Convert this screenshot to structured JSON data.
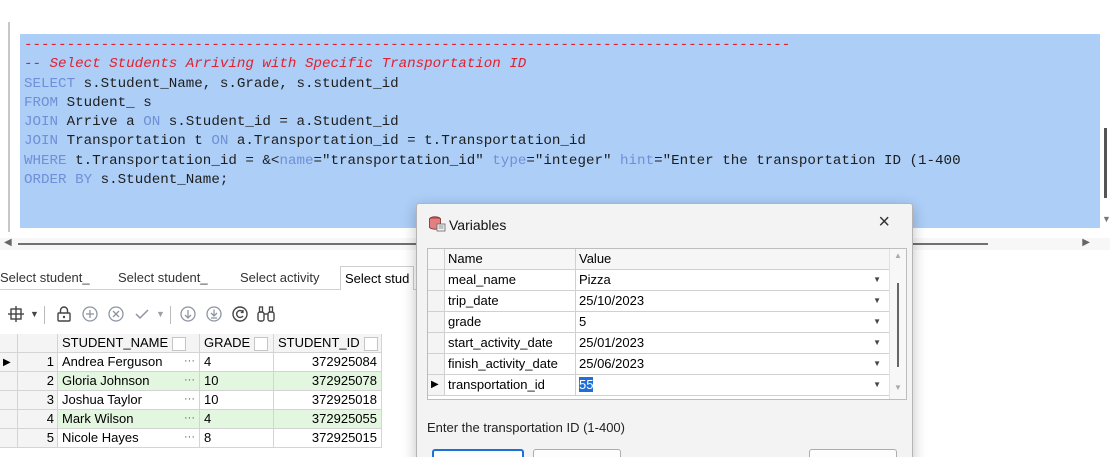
{
  "editor": {
    "lines": [
      [
        {
          "t": "------------------------------------------------------------------------------------------",
          "c": "c-comment"
        }
      ],
      [
        {
          "t": "-- Select Students Arriving with Specific Transportation ID",
          "c": "c-comment"
        }
      ],
      [
        {
          "t": "SELECT",
          "c": "c-kw"
        },
        {
          "t": " s.Student_Name, s.Grade, s.student_id",
          "c": "c-plain"
        }
      ],
      [
        {
          "t": "FROM",
          "c": "c-kw"
        },
        {
          "t": " Student_ s",
          "c": "c-plain"
        }
      ],
      [
        {
          "t": "JOIN",
          "c": "c-kw"
        },
        {
          "t": " Arrive a ",
          "c": "c-plain"
        },
        {
          "t": "ON",
          "c": "c-kw"
        },
        {
          "t": " s.Student_id = a.Student_id",
          "c": "c-plain"
        }
      ],
      [
        {
          "t": "JOIN",
          "c": "c-kw"
        },
        {
          "t": " Transportation t ",
          "c": "c-plain"
        },
        {
          "t": "ON",
          "c": "c-kw"
        },
        {
          "t": " a.Transportation_id = t.Transportation_id",
          "c": "c-plain"
        }
      ],
      [
        {
          "t": "WHERE",
          "c": "c-kw"
        },
        {
          "t": " t.Transportation_id = &<",
          "c": "c-plain"
        },
        {
          "t": "name",
          "c": "c-kw"
        },
        {
          "t": "=\"transportation_id\" ",
          "c": "c-plain"
        },
        {
          "t": "type",
          "c": "c-kw"
        },
        {
          "t": "=\"integer\" ",
          "c": "c-plain"
        },
        {
          "t": "hint",
          "c": "c-kw"
        },
        {
          "t": "=\"Enter the transportation ID (1-400",
          "c": "c-plain"
        }
      ],
      [
        {
          "t": "ORDER BY",
          "c": "c-kw"
        },
        {
          "t": " s.Student_Name;",
          "c": "c-plain"
        }
      ]
    ]
  },
  "tabs": [
    "Select student_",
    "Select student_",
    "Select activity",
    "Select stud"
  ],
  "grid": {
    "headers": [
      "STUDENT_NAME",
      "GRADE",
      "STUDENT_ID"
    ],
    "rows": [
      {
        "num": "1",
        "name": "Andrea Ferguson",
        "dots": "···",
        "grade": "4",
        "id": "372925084"
      },
      {
        "num": "2",
        "name": "Gloria Johnson",
        "dots": "···",
        "grade": "10",
        "id": "372925078"
      },
      {
        "num": "3",
        "name": "Joshua Taylor",
        "dots": "···",
        "grade": "10",
        "id": "372925018"
      },
      {
        "num": "4",
        "name": "Mark Wilson",
        "dots": "···",
        "grade": "4",
        "id": "372925055"
      },
      {
        "num": "5",
        "name": "Nicole Hayes",
        "dots": "···",
        "grade": "8",
        "id": "372925015"
      }
    ]
  },
  "dialog": {
    "title": "Variables",
    "close": "×",
    "headers": {
      "name": "Name",
      "value": "Value"
    },
    "variables": [
      {
        "name": "meal_name",
        "value": "Pizza"
      },
      {
        "name": "trip_date",
        "value": "25/10/2023"
      },
      {
        "name": "grade",
        "value": "5"
      },
      {
        "name": "start_activity_date",
        "value": "25/01/2023"
      },
      {
        "name": "finish_activity_date",
        "value": "25/06/2023"
      },
      {
        "name": "transportation_id",
        "value": "55"
      }
    ],
    "hint": "Enter the transportation ID (1-400)"
  }
}
